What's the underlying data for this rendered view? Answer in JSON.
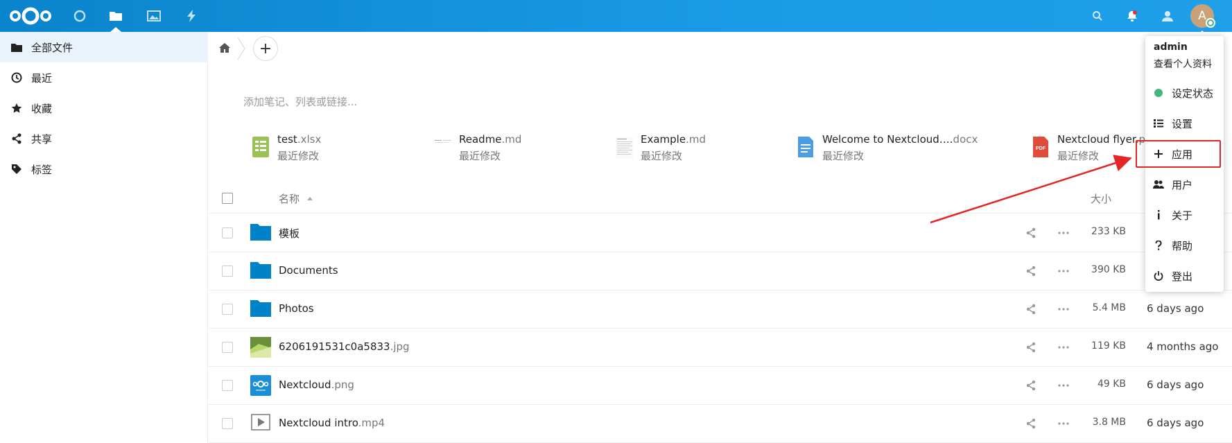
{
  "header": {
    "apps": [
      {
        "name": "dashboard",
        "icon": "circle-icon"
      },
      {
        "name": "files",
        "icon": "folder-icon",
        "active": true
      },
      {
        "name": "photos",
        "icon": "image-icon"
      },
      {
        "name": "activity",
        "icon": "lightning-icon"
      }
    ],
    "right_icons": [
      "search-icon",
      "bell-icon",
      "contacts-icon"
    ],
    "avatar_letter": "A"
  },
  "sidebar": {
    "items": [
      {
        "label": "全部文件",
        "icon": "folder-icon",
        "active": true
      },
      {
        "label": "最近",
        "icon": "clock-icon"
      },
      {
        "label": "收藏",
        "icon": "star-icon"
      },
      {
        "label": "共享",
        "icon": "share-icon"
      },
      {
        "label": "标签",
        "icon": "tag-icon"
      }
    ]
  },
  "main": {
    "add_symbol": "+",
    "notes_placeholder": "添加笔记、列表或链接...",
    "recent_files": [
      {
        "name": "test",
        "ext": ".xlsx",
        "sub": "最近修改",
        "icon": "spreadsheet-icon"
      },
      {
        "name": "Readme",
        "ext": ".md",
        "sub": "最近修改",
        "icon": "text-file-icon"
      },
      {
        "name": "Example",
        "ext": ".md",
        "sub": "最近修改",
        "icon": "text-file-icon"
      },
      {
        "name": "Welcome to Nextcloud….",
        "ext": "docx",
        "sub": "最近修改",
        "icon": "document-icon"
      },
      {
        "name": "Nextcloud flyer.",
        "ext": "p",
        "sub": "最近修改",
        "icon": "pdf-icon"
      }
    ],
    "list_header": {
      "name": "名称",
      "size": "大小"
    },
    "files": [
      {
        "name": "模板",
        "ext": "",
        "size": "233 KB",
        "modified": "",
        "icon": "folder-icon"
      },
      {
        "name": "Documents",
        "ext": "",
        "size": "390 KB",
        "modified": "",
        "icon": "folder-icon"
      },
      {
        "name": "Photos",
        "ext": "",
        "size": "5.4 MB",
        "modified": "6 days ago",
        "icon": "folder-icon"
      },
      {
        "name": "6206191531c0a5833",
        "ext": ".jpg",
        "size": "119 KB",
        "modified": "4 months ago",
        "icon": "image-thumb-icon"
      },
      {
        "name": "Nextcloud",
        "ext": ".png",
        "size": "49 KB",
        "modified": "6 days ago",
        "icon": "nextcloud-thumb-icon"
      },
      {
        "name": "Nextcloud intro",
        "ext": ".mp4",
        "size": "3.8 MB",
        "modified": "6 days ago",
        "icon": "video-icon"
      }
    ]
  },
  "user_menu": {
    "username": "admin",
    "profile_link": "查看个人资料",
    "items": [
      {
        "label": "设定状态",
        "icon": "status-dot-icon"
      },
      {
        "label": "设置",
        "icon": "settings-list-icon"
      },
      {
        "label": "应用",
        "icon": "plus-icon",
        "highlighted": true
      },
      {
        "label": "用户",
        "icon": "users-icon"
      },
      {
        "label": "关于",
        "icon": "info-icon"
      },
      {
        "label": "帮助",
        "icon": "help-icon"
      },
      {
        "label": "登出",
        "icon": "power-icon"
      }
    ]
  },
  "colors": {
    "header": "#0a84cc",
    "folder": "#0082c9",
    "status_online": "#49b382",
    "annotation_red": "#e52525"
  }
}
